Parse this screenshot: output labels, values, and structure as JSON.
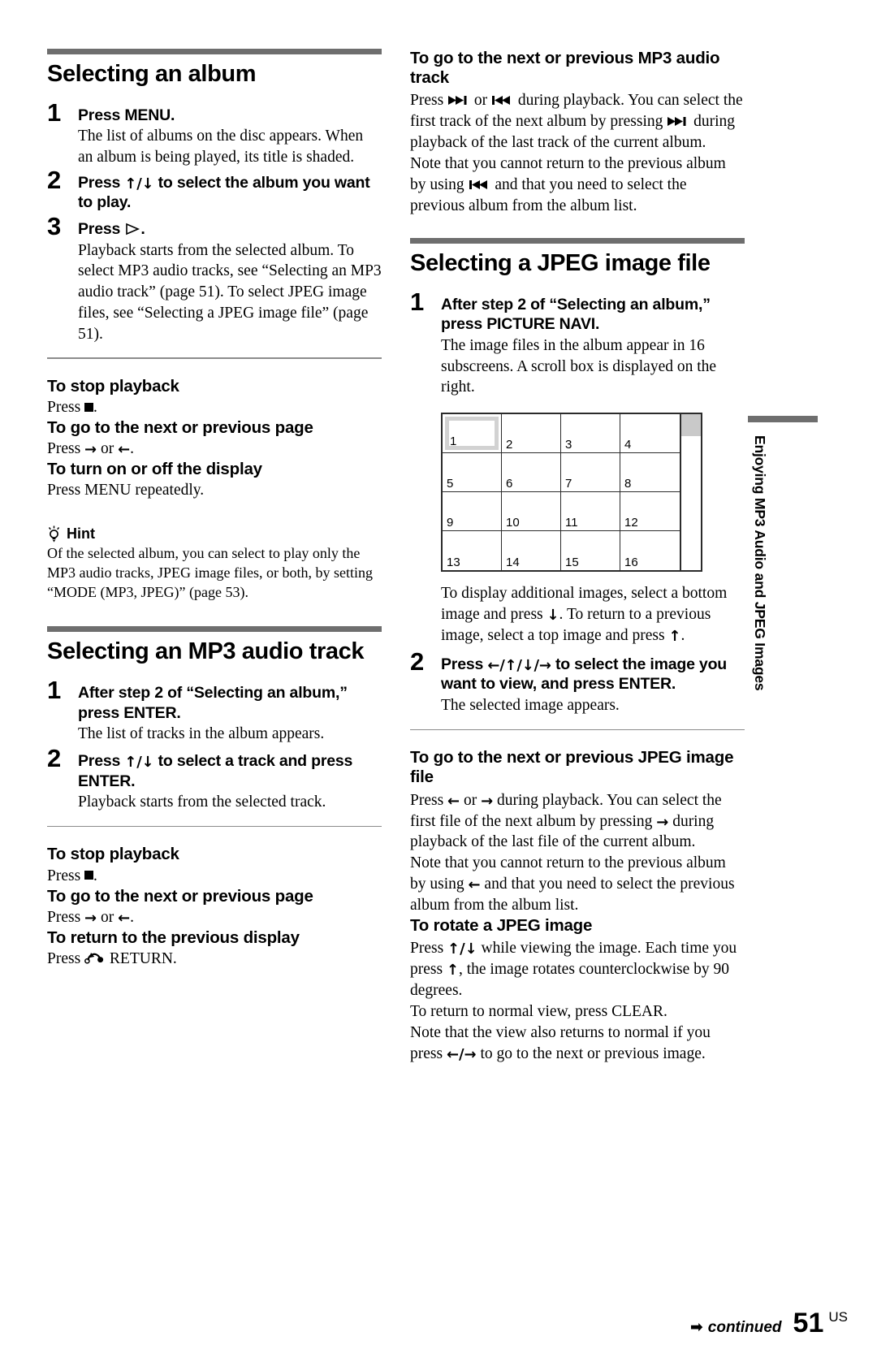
{
  "page": {
    "number": "51",
    "region_code": "US",
    "continued_label": "continued",
    "continued_arrow": "➡",
    "side_tab_label": "Enjoying MP3 Audio and JPEG Images"
  },
  "icons": {
    "up": "↑",
    "down": "↓",
    "left": "←",
    "right": "→",
    "play": "play-triangle",
    "stop": "stop-square",
    "next_track": "next-track",
    "prev_track": "prev-track",
    "return": "return-curved-arrow",
    "hint_bulb": "lightbulb"
  },
  "left_column": {
    "section_album": {
      "title": "Selecting an album",
      "steps": [
        {
          "num": "1",
          "head": "Press MENU.",
          "body": "The list of albums on the disc appears. When an album is being played, its title is shaded."
        },
        {
          "num": "2",
          "head_pre": "Press ",
          "head_arrows": "↑/↓",
          "head_post": " to select the album you want to play.",
          "body": ""
        },
        {
          "num": "3",
          "head_pre": "Press ",
          "head_post": ".",
          "body": "Playback starts from the selected album. To select MP3 audio tracks, see “Selecting an MP3 audio track” (page 51). To select JPEG image files, see “Selecting a JPEG image file” (page 51)."
        }
      ],
      "sub_stop": {
        "title": "To stop playback",
        "press_label": "Press ",
        "tail": "."
      },
      "sub_page": {
        "title": "To go to the next or previous page",
        "press_label": "Press ",
        "arrow_a": "→",
        "or_label": " or ",
        "arrow_b": "←",
        "tail": "."
      },
      "sub_display": {
        "title": "To turn on or off the display",
        "body": "Press MENU repeatedly."
      },
      "hint": {
        "label": "Hint",
        "body": "Of the selected album, you can select to play only the MP3 audio tracks, JPEG image files, or both, by setting “MODE (MP3, JPEG)” (page 53)."
      }
    },
    "section_mp3": {
      "title": "Selecting an MP3 audio track",
      "steps": [
        {
          "num": "1",
          "head": "After step 2 of “Selecting an album,” press ENTER.",
          "body": "The list of tracks in the album appears."
        },
        {
          "num": "2",
          "head_pre": "Press ",
          "head_arrows": "↑/↓",
          "head_post": " to select a track and press ENTER.",
          "body": "Playback starts from the selected track."
        }
      ],
      "sub_stop": {
        "title": "To stop playback",
        "press_label": "Press ",
        "tail": "."
      },
      "sub_page": {
        "title": "To go to the next or previous page",
        "press_label": "Press ",
        "arrow_a": "→",
        "or_label": " or ",
        "arrow_b": "←",
        "tail": "."
      },
      "sub_return": {
        "title": "To return to the previous display",
        "press_label": "Press ",
        "tail": " RETURN."
      }
    }
  },
  "right_column": {
    "sub_next_track": {
      "title": "To go to the next or previous MP3 audio track",
      "line1_a": "Press ",
      "line1_b": " or ",
      "line1_c": " during playback. You can select the first track of the next album by pressing ",
      "line1_d": " during playback of the last track of the current album.",
      "line2_a": "Note that you cannot return to the previous album by using ",
      "line2_b": " and that you need to select the previous album from the album list."
    },
    "section_jpeg": {
      "title": "Selecting a JPEG image file",
      "step1": {
        "num": "1",
        "head": "After step 2 of “Selecting an album,” press PICTURE NAVI.",
        "body": "The image files in the album appear in 16 subscreens. A scroll box is displayed on the right."
      },
      "figure": {
        "cells": [
          "1",
          "2",
          "3",
          "4",
          "5",
          "6",
          "7",
          "8",
          "9",
          "10",
          "11",
          "12",
          "13",
          "14",
          "15",
          "16"
        ],
        "selected_cell": "1",
        "has_scrollbox": true
      },
      "after_figure": {
        "a": "To display additional images, select a bottom image and press ",
        "b": ". To return to a previous image, select a top image and press ",
        "c": "."
      },
      "step2": {
        "num": "2",
        "head_pre": "Press ",
        "head_arrows": "←/↑/↓/→",
        "head_post": " to select the image you want to view, and press ENTER.",
        "body": "The selected image appears."
      }
    },
    "sub_next_file": {
      "title": "To go to the next or previous JPEG image file",
      "line1_a": "Press ",
      "line1_b": " or ",
      "line1_c": " during playback. You can select the first file of the next album by pressing ",
      "line1_d": " during playback of the last file of the current album.",
      "line2_a": "Note that you cannot return to the previous album by using ",
      "line2_b": " and that you need to select the previous album from the album list."
    },
    "sub_rotate": {
      "title": "To rotate a JPEG image",
      "line1_a": "Press ",
      "line1_arrows": "↑/↓",
      "line1_b": " while viewing the image. Each time you press ",
      "line1_c": ", the image rotates counterclockwise by 90 degrees.",
      "line2": "To return to normal view, press CLEAR.",
      "line3_a": "Note that the view also returns to normal if you press ",
      "line3_arrows": "←/→",
      "line3_b": " to go to the next or previous image."
    }
  }
}
